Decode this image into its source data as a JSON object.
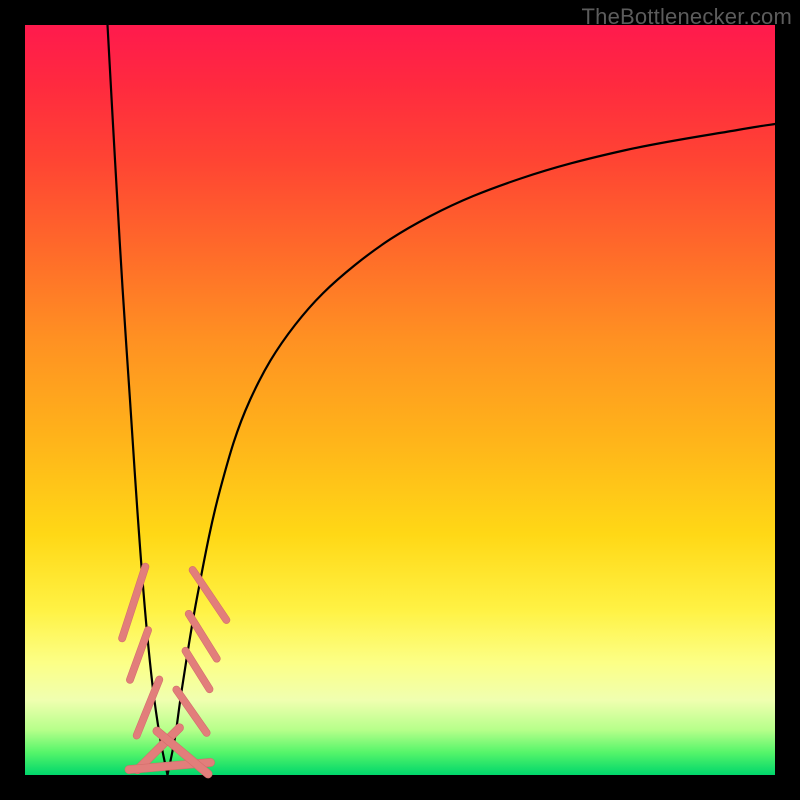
{
  "watermark": "TheBottlenecker.com",
  "colors": {
    "lozenge_fill": "#e27e7b",
    "lozenge_stroke": "#d46e6b",
    "curve_stroke": "#000000"
  },
  "chart_data": {
    "type": "line",
    "title": "",
    "xlabel": "",
    "ylabel": "",
    "xlim": [
      0,
      100
    ],
    "ylim": [
      0,
      100
    ],
    "x_notch": 19,
    "series": [
      {
        "name": "left-branch",
        "x": [
          11,
          12,
          13,
          14,
          15,
          16,
          17,
          18,
          19
        ],
        "y": [
          100,
          82,
          65,
          50,
          35,
          22,
          12,
          5,
          0
        ]
      },
      {
        "name": "right-branch",
        "x": [
          19,
          20,
          21,
          23,
          26,
          30,
          36,
          44,
          54,
          66,
          80,
          95,
          100
        ],
        "y": [
          0,
          5,
          12,
          24,
          38,
          50,
          60,
          68,
          74.5,
          79.5,
          83.3,
          86,
          86.8
        ]
      }
    ],
    "markers": {
      "name": "highlighted-points",
      "comment": "salmon lozenge markers clustered near the notch",
      "points": [
        {
          "x": 14.5,
          "y": 23,
          "len": 11,
          "angle": -72,
          "w": 8
        },
        {
          "x": 15.2,
          "y": 16,
          "len": 8,
          "angle": -70,
          "w": 8
        },
        {
          "x": 16.4,
          "y": 9,
          "len": 9,
          "angle": -68,
          "w": 8
        },
        {
          "x": 17.8,
          "y": 3.5,
          "len": 9,
          "angle": -45,
          "w": 9
        },
        {
          "x": 19.3,
          "y": 1.2,
          "len": 12,
          "angle": -5,
          "w": 9
        },
        {
          "x": 21.0,
          "y": 3.0,
          "len": 10,
          "angle": 40,
          "w": 9
        },
        {
          "x": 22.2,
          "y": 8.5,
          "len": 8,
          "angle": 55,
          "w": 8
        },
        {
          "x": 23.0,
          "y": 14,
          "len": 7,
          "angle": 58,
          "w": 8
        },
        {
          "x": 23.7,
          "y": 18.5,
          "len": 8,
          "angle": 58,
          "w": 8
        },
        {
          "x": 24.6,
          "y": 24,
          "len": 9,
          "angle": 56,
          "w": 8
        }
      ]
    }
  }
}
